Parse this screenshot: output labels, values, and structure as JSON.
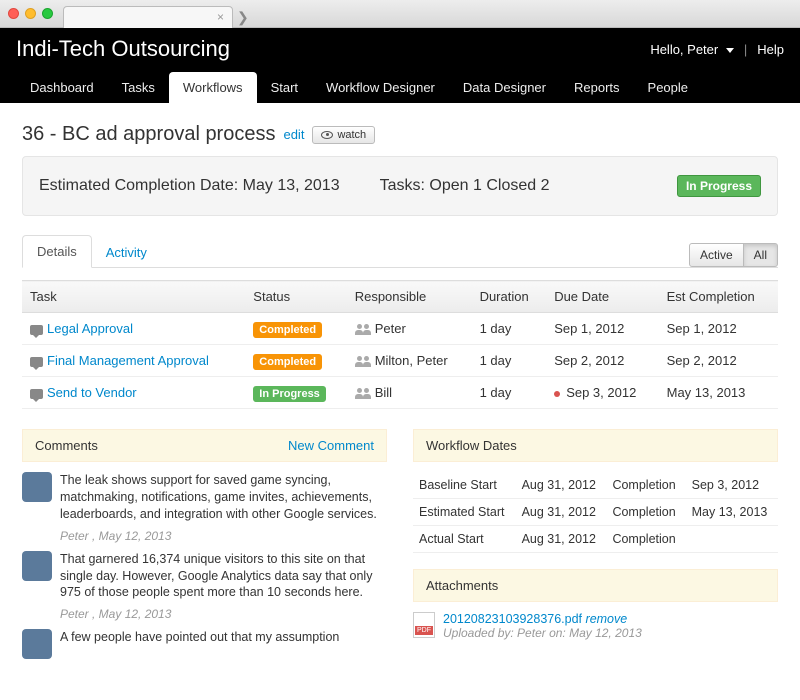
{
  "chrome": {
    "tab_title": "",
    "close": "×",
    "newtab": "❯"
  },
  "header": {
    "brand": "Indi-Tech Outsourcing",
    "greeting": "Hello, Peter",
    "help": "Help"
  },
  "nav": {
    "items": [
      "Dashboard",
      "Tasks",
      "Workflows",
      "Start",
      "Workflow Designer",
      "Data Designer",
      "Reports",
      "People"
    ],
    "active_index": 2
  },
  "title": {
    "text": "36 - BC ad approval process",
    "edit": "edit",
    "watch": "watch"
  },
  "summary": {
    "est_label": "Estimated Completion Date: May 13, 2013",
    "tasks_label": "Tasks: Open 1 Closed 2",
    "status": "In Progress"
  },
  "subtabs": {
    "details": "Details",
    "activity": "Activity"
  },
  "filters": {
    "active": "Active",
    "all": "All"
  },
  "table": {
    "headers": {
      "task": "Task",
      "status": "Status",
      "responsible": "Responsible",
      "duration": "Duration",
      "due": "Due Date",
      "est": "Est Completion"
    },
    "rows": [
      {
        "task": "Legal Approval",
        "status": "Completed",
        "status_color": "orange",
        "responsible": "Peter",
        "duration": "1 day",
        "due": "Sep 1, 2012",
        "overdue": false,
        "est": "Sep 1, 2012"
      },
      {
        "task": "Final Management Approval",
        "status": "Completed",
        "status_color": "orange",
        "responsible": "Milton, Peter",
        "duration": "1 day",
        "due": "Sep 2, 2012",
        "overdue": false,
        "est": "Sep 2, 2012"
      },
      {
        "task": "Send to Vendor",
        "status": "In Progress",
        "status_color": "green",
        "responsible": "Bill",
        "duration": "1 day",
        "due": "Sep 3, 2012",
        "overdue": true,
        "est": "May 13, 2013"
      }
    ]
  },
  "comments": {
    "header": "Comments",
    "new": "New Comment",
    "items": [
      {
        "text": "The leak shows support for saved game syncing, matchmaking, notifications, game invites, achievements, leaderboards, and integration with other Google services.",
        "meta": "Peter , May 12, 2013"
      },
      {
        "text": "That garnered 16,374 unique visitors to this site on that single day. However, Google Analytics data say that only 975 of those people spent more than 10 seconds here.",
        "meta": "Peter , May 12, 2013"
      },
      {
        "text": "A few people have pointed out that my assumption",
        "meta": ""
      }
    ]
  },
  "dates": {
    "header": "Workflow Dates",
    "rows": [
      {
        "l1": "Baseline Start",
        "v1": "Aug 31, 2012",
        "l2": "Completion",
        "v2": "Sep 3, 2012"
      },
      {
        "l1": "Estimated Start",
        "v1": "Aug 31, 2012",
        "l2": "Completion",
        "v2": "May 13, 2013"
      },
      {
        "l1": "Actual Start",
        "v1": "Aug 31, 2012",
        "l2": "Completion",
        "v2": ""
      }
    ]
  },
  "attachments": {
    "header": "Attachments",
    "file": "20120823103928376.pdf",
    "remove": "remove",
    "uploaded": "Uploaded by: Peter on: May 12, 2013"
  }
}
